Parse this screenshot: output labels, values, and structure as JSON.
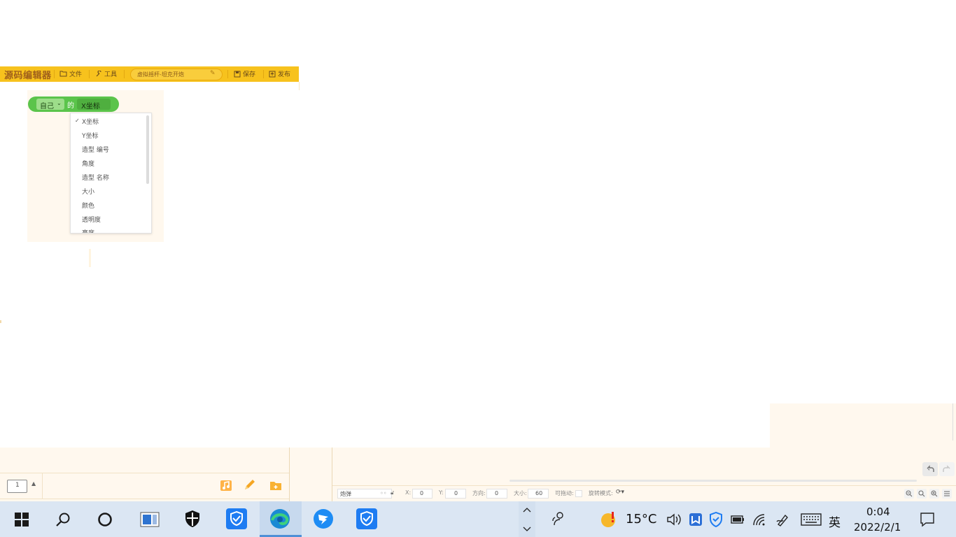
{
  "toolbar": {
    "logo": "源码编辑器",
    "file": "文件",
    "tools": "工具",
    "project_name": "虚拟摇杆-坦克开炮",
    "save": "保存",
    "publish": "发布"
  },
  "block": {
    "subject": "自己",
    "connector": "的",
    "property": "X坐标"
  },
  "dropdown": {
    "selected": "X坐标",
    "options": [
      "X坐标",
      "Y坐标",
      "造型 编号",
      "角度",
      "造型 名称",
      "大小",
      "颜色",
      "透明度",
      "亮度"
    ]
  },
  "scene": {
    "page_number": "1"
  },
  "sprite_bar": {
    "name": "炮弹",
    "x_label": "X:",
    "x_value": "0",
    "y_label": "Y:",
    "y_value": "0",
    "direction_label": "方向:",
    "direction_value": "0",
    "size_label": "大小:",
    "size_value": "60",
    "draggable_label": "可拖动:",
    "rotation_label": "旋转模式:"
  },
  "taskbar": {
    "temperature": "15°C",
    "ime": "英",
    "time": "0:04",
    "date": "2022/2/1"
  },
  "icons": {
    "start": "windows-logo-icon",
    "search": "search-icon",
    "cortana": "cortana-circle-icon",
    "taskview": "task-view-icon",
    "security": "shield-icon",
    "edge": "edge-browser-icon"
  },
  "colors": {
    "toolbar": "#f7c21d",
    "block_green": "#5bc44b",
    "panel_cream": "#fff8ee",
    "taskbar": "#dbe6f3"
  }
}
